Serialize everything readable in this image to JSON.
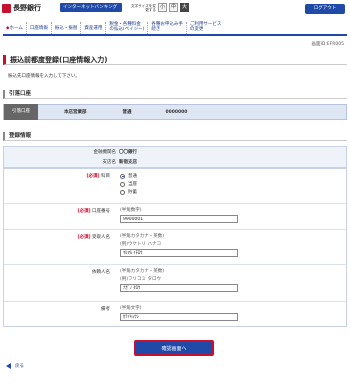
{
  "header": {
    "bank_name": "長野銀行",
    "service_banner": "インターネットバンキング",
    "font_size_label": "文字サイズを変更する",
    "font_sizes": [
      "小",
      "中",
      "大"
    ],
    "logout": "ログアウト"
  },
  "nav": {
    "items": [
      {
        "label": "ホーム"
      },
      {
        "label": "口座情報"
      },
      {
        "label": "振込・振替"
      },
      {
        "label": "資産運用"
      },
      {
        "label1": "税金・各種料金",
        "label2": "の払込(ペイジー)"
      },
      {
        "label1": "各種お申込み手",
        "label2": "続き"
      },
      {
        "label1": "ご利用サービス",
        "label2": "の変更"
      }
    ]
  },
  "screen_id": "画面ID:EFR005",
  "page_title": "振込前都度登録(口座情報入力)",
  "instruction": "振込先口座情報を入力して下さい。",
  "debit_section": {
    "title": "引落口座",
    "label": "引落口座",
    "branch": "本店営業部",
    "type": "普通",
    "account": "0000000"
  },
  "registration": {
    "title": "登録情報",
    "info": [
      {
        "key": "金融機関名",
        "value": "〇〇銀行"
      },
      {
        "key": "支店名",
        "value": "新宿支店"
      }
    ]
  },
  "form": {
    "subject": {
      "required": "[必須]",
      "label": "科目",
      "options": [
        "普通",
        "当座",
        "貯蓄"
      ],
      "selected": "普通"
    },
    "account": {
      "required": "[必須]",
      "label": "口座番号",
      "hint": "(半角数字)",
      "value": "9900001"
    },
    "recipient": {
      "required": "[必須]",
      "label": "受取人名",
      "hint": "(半角カタカナ・英数)",
      "example": "(例)ウケトリ ハナコ",
      "value": "ﾏﾙﾏﾙ ｲﾁﾛｳ"
    },
    "requester": {
      "label": "依頼人名",
      "hint": "(半角カタカナ・英数)",
      "example": "(例)フリコミ タロウ",
      "value": "ﾅｶﾞﾉ ﾀﾛｳ"
    },
    "memo": {
      "label": "備考",
      "hint": "(半角文字)",
      "value": "ｶﾃｲｷｮｳｼ"
    }
  },
  "confirm_button": "確認画面へ",
  "back_link": "戻る"
}
